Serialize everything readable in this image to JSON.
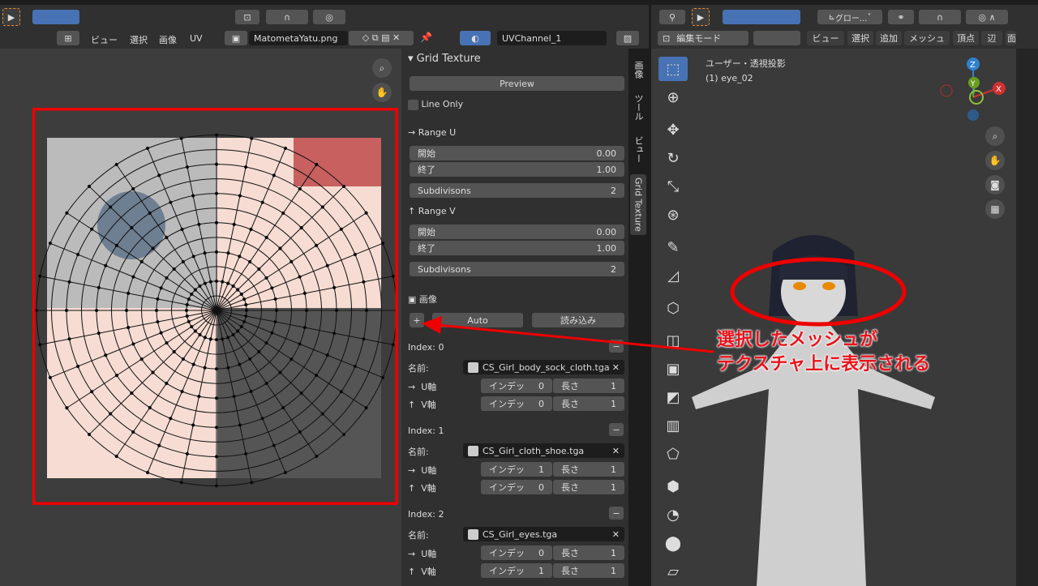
{
  "uv_header": {
    "menus": [
      "ビュー",
      "選択",
      "画像",
      "UV"
    ],
    "image_name": "MatometaYatu.png",
    "uv_map": "UVChannel_1"
  },
  "panel": {
    "title": "Grid Texture",
    "preview": "Preview",
    "line_only": "Line Only",
    "range_u": {
      "label": "Range U",
      "start_label": "開始",
      "start": "0.00",
      "end_label": "終了",
      "end": "1.00",
      "subdiv_label": "Subdivisons",
      "subdiv": "2"
    },
    "range_v": {
      "label": "Range V",
      "start_label": "開始",
      "start": "0.00",
      "end_label": "終了",
      "end": "1.00",
      "subdiv_label": "Subdivisons",
      "subdiv": "2"
    },
    "image_label": "画像",
    "auto": "Auto",
    "load": "読み込み",
    "add": "+",
    "indices": [
      {
        "label": "Index: 0",
        "name_label": "名前:",
        "file": "CS_Girl_body_sock_cloth.tga",
        "u_label": "U軸",
        "v_label": "V軸",
        "u_index": "0",
        "u_len": "1",
        "v_index": "0",
        "v_len": "1"
      },
      {
        "label": "Index: 1",
        "name_label": "名前:",
        "file": "CS_Girl_cloth_shoe.tga",
        "u_label": "U軸",
        "v_label": "V軸",
        "u_index": "1",
        "u_len": "1",
        "v_index": "0",
        "v_len": "1"
      },
      {
        "label": "Index: 2",
        "name_label": "名前:",
        "file": "CS_Girl_eyes.tga",
        "u_label": "U軸",
        "v_label": "V軸",
        "u_index": "0",
        "u_len": "1",
        "v_index": "1",
        "v_len": "1"
      }
    ],
    "index_word": "インデッ",
    "length_word": "長さ"
  },
  "side_tabs": [
    "画像",
    "ツール",
    "ビュー",
    "Grid Texture"
  ],
  "viewport": {
    "orientation": "グロー...",
    "mode": "編集モード",
    "menus": [
      "ビュー",
      "選択",
      "追加",
      "メッシュ",
      "頂点",
      "辺",
      "面"
    ],
    "view_name": "ユーザー・透視投影",
    "object": "(1) eye_02",
    "axes": [
      "Z",
      "Y",
      "X"
    ]
  },
  "annotation": {
    "line1": "選択したメッシュが",
    "line2": "テクスチャ上に表示される",
    "color": "#e8141c"
  }
}
